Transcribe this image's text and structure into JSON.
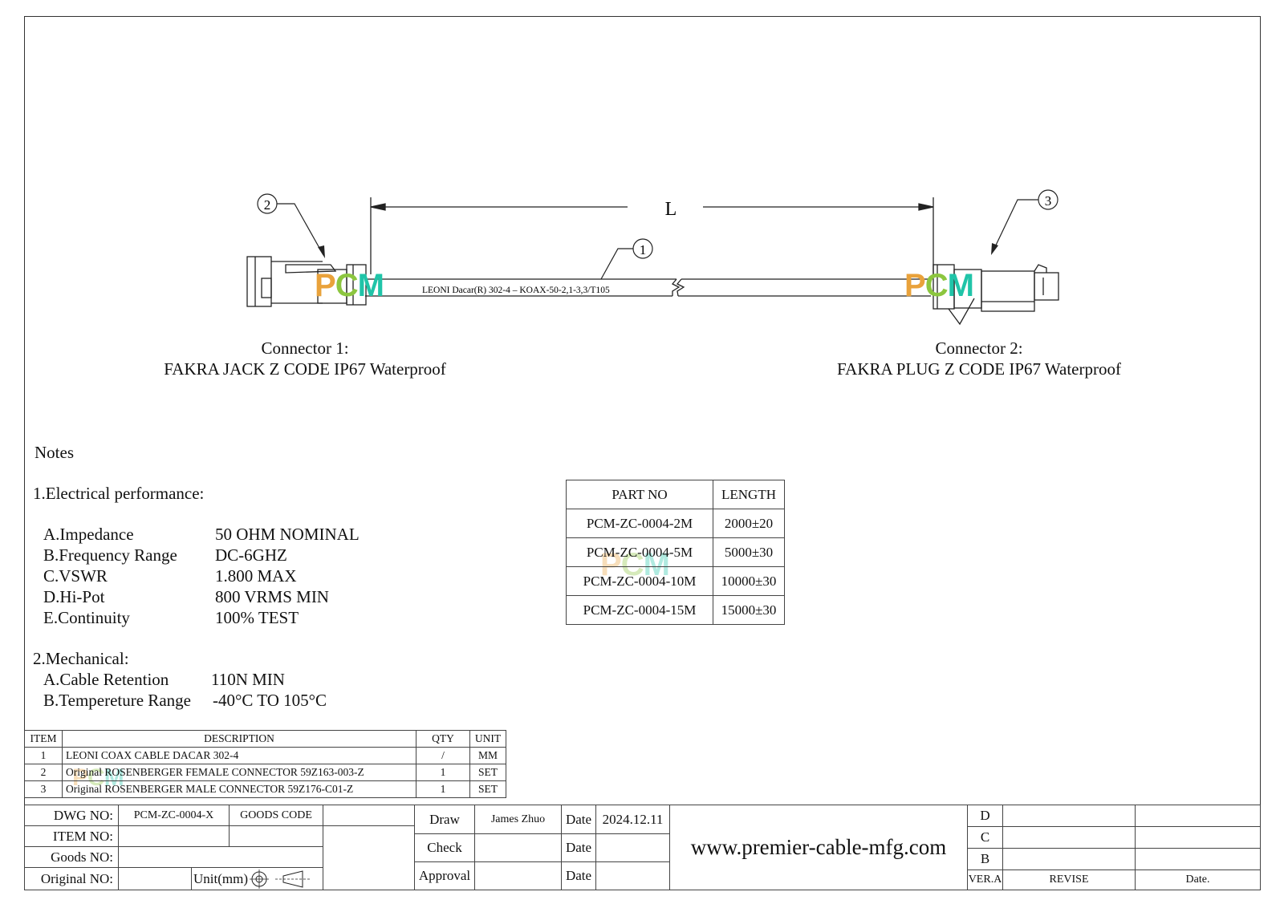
{
  "drawing": {
    "dimension_label": "L",
    "cable_label": "LEONI Dacar(R) 302-4 – KOAX-50-2,1-3,3/T105",
    "balloons": [
      "1",
      "2",
      "3"
    ],
    "watermark": {
      "p": "P",
      "c": "C",
      "m": "M"
    },
    "connector1": {
      "title": "Connector 1:",
      "desc": "FAKRA JACK Z CODE IP67 Waterproof"
    },
    "connector2": {
      "title": "Connector 2:",
      "desc": "FAKRA PLUG Z CODE IP67 Waterproof"
    }
  },
  "notes": {
    "title": "Notes",
    "electrical": {
      "heading": "1.Electrical performance:",
      "items": [
        {
          "label": "A.Impedance",
          "value": "50 OHM NOMINAL"
        },
        {
          "label": "B.Frequency Range",
          "value": "DC-6GHZ"
        },
        {
          "label": "C.VSWR",
          "value": "1.800 MAX"
        },
        {
          "label": "D.Hi-Pot",
          "value": "800 VRMS MIN"
        },
        {
          "label": "E.Continuity",
          "value": "100% TEST"
        }
      ]
    },
    "mechanical": {
      "heading": "2.Mechanical:",
      "items": [
        {
          "label": "A.Cable Retention",
          "value": "110N MIN"
        },
        {
          "label": "B.Tempereture Range",
          "value": "-40°C TO 105°C"
        }
      ]
    }
  },
  "part_table": {
    "headers": [
      "PART NO",
      "LENGTH"
    ],
    "rows": [
      [
        "PCM-ZC-0004-2M",
        "2000±20"
      ],
      [
        "PCM-ZC-0004-5M",
        "5000±30"
      ],
      [
        "PCM-ZC-0004-10M",
        "10000±30"
      ],
      [
        "PCM-ZC-0004-15M",
        "15000±30"
      ]
    ]
  },
  "bom": {
    "headers": [
      "ITEM",
      "DESCRIPTION",
      "QTY",
      "UNIT"
    ],
    "rows": [
      [
        "1",
        "LEONI COAX CABLE DACAR 302-4",
        "/",
        "MM"
      ],
      [
        "2",
        "Original ROSENBERGER FEMALE CONNECTOR 59Z163-003-Z",
        "1",
        "SET"
      ],
      [
        "3",
        "Original ROSENBERGER MALE CONNECTOR 59Z176-C01-Z",
        "1",
        "SET"
      ]
    ]
  },
  "title_block": {
    "dwg_no_label": "DWG NO:",
    "dwg_no": "PCM-ZC-0004-X",
    "goods_code_label": "GOODS CODE",
    "item_no_label": "ITEM NO:",
    "goods_no_label": "Goods NO:",
    "original_no_label": "Original NO:",
    "unit_label": "Unit(mm)",
    "draw_label": "Draw",
    "draw_name": "James Zhuo",
    "date_label": "Date",
    "draw_date": "2024.12.11",
    "check_label": "Check",
    "approval_label": "Approval",
    "website": "www.premier-cable-mfg.com",
    "revisions": [
      "D",
      "C",
      "B",
      "VER.A"
    ],
    "revise_label": "REVISE",
    "rev_date_label": "Date."
  }
}
